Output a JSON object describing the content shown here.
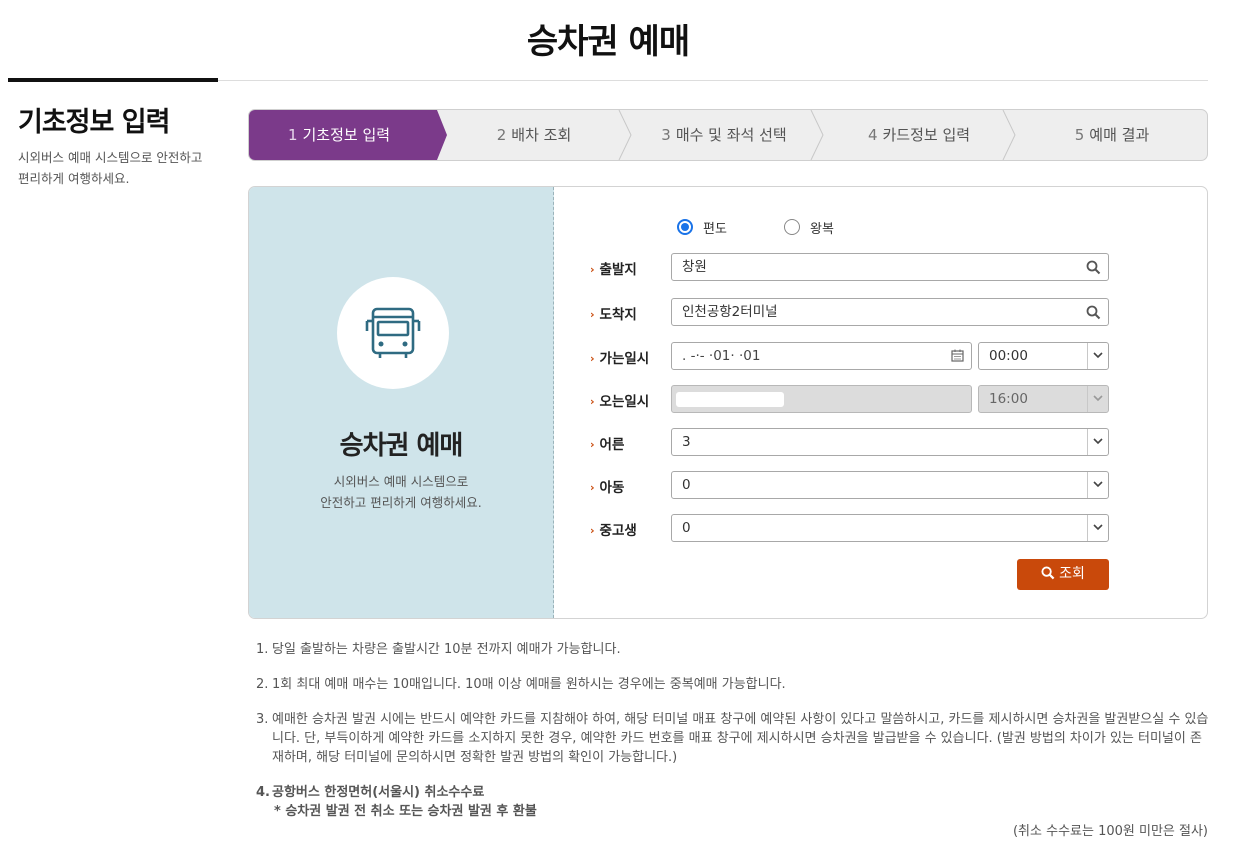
{
  "page_title": "승차권 예매",
  "sidebar": {
    "title": "기초정보 입력",
    "description": "시외버스 예매 시스템으로 안전하고 편리하게 여행하세요."
  },
  "steps": [
    {
      "num": "1",
      "label": "기초정보 입력",
      "active": true
    },
    {
      "num": "2",
      "label": "배차 조회",
      "active": false
    },
    {
      "num": "3",
      "label": "매수 및 좌석 선택",
      "active": false
    },
    {
      "num": "4",
      "label": "카드정보 입력",
      "active": false
    },
    {
      "num": "5",
      "label": "예매 결과",
      "active": false
    }
  ],
  "panel": {
    "title": "승차권 예매",
    "desc_line1": "시외버스 예매 시스템으로",
    "desc_line2": "안전하고 편리하게 여행하세요.",
    "icon": "bus-icon"
  },
  "form": {
    "trip_type": {
      "one_way": "편도",
      "round_trip": "왕복",
      "selected": "편도"
    },
    "departure": {
      "label": "출발지",
      "value": "창원"
    },
    "arrival": {
      "label": "도착지",
      "value": "인천공항2터미널"
    },
    "depart_date": {
      "label": "가는일시",
      "value": ".   -·-  ·01·  ·01",
      "time": "00:00"
    },
    "return_date": {
      "label": "오는일시",
      "value": "",
      "time": "16:00"
    },
    "adult": {
      "label": "어른",
      "value": "3"
    },
    "child": {
      "label": "아동",
      "value": "0"
    },
    "student": {
      "label": "중고생",
      "value": "0"
    },
    "search_button": "조회"
  },
  "notes": [
    {
      "n": "1.",
      "text": "당일 출발하는 차량은 출발시간 10분 전까지 예매가 가능합니다."
    },
    {
      "n": "2.",
      "text": "1회 최대 예매 매수는 10매입니다. 10매 이상 예매를 원하시는 경우에는 중복예매 가능합니다."
    },
    {
      "n": "3.",
      "text": "예매한 승차권 발권 시에는 반드시 예약한 카드를 지참해야 하여, 해당 터미널 매표 창구에 예약된 사항이 있다고 말씀하시고, 카드를 제시하시면 승차권을 발권받으실 수 있습니다. 단, 부득이하게 예약한 카드를 소지하지 못한 경우, 예약한 카드 번호를 매표 창구에 제시하시면 승차권을 발급받을 수 있습니다. (발권 방법의 차이가 있는 터미널이 존재하며, 해당 터미널에 문의하시면 정확한 발권 방법의 확인이 가능합니다.)"
    },
    {
      "n": "4.",
      "text": "공항버스 한정면허(서울시) 취소수수료",
      "sub": "* 승차권 발권 전 취소 또는 승차권 발권 후 환불"
    }
  ],
  "fee_note": "(취소 수수료는 100원 미만은 절사)",
  "colors": {
    "accent_purple": "#7b3a8a",
    "button_orange": "#c9490b",
    "panel_blue": "#cfe4ea"
  }
}
